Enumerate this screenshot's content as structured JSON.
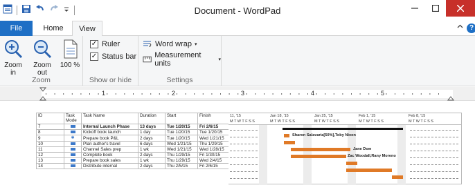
{
  "window": {
    "title": "Document - WordPad"
  },
  "tabs": {
    "file": "File",
    "home": "Home",
    "view": "View"
  },
  "ribbon": {
    "zoom_group": {
      "zoom_in": "Zoom in",
      "zoom_out": "Zoom out",
      "zoom_100": "100 %",
      "label": "Zoom"
    },
    "show_hide_group": {
      "ruler": "Ruler",
      "ruler_checked": true,
      "status_bar": "Status bar",
      "status_bar_checked": true,
      "label": "Show or hide"
    },
    "settings_group": {
      "word_wrap": "Word wrap",
      "measurement_units": "Measurement units",
      "label": "Settings"
    }
  },
  "ruler": {
    "marks": [
      "1",
      "2",
      "3",
      "4",
      "5"
    ]
  },
  "gantt": {
    "headers": {
      "id": "ID",
      "mode": "Task Mode",
      "name": "Task Name",
      "duration": "Duration",
      "start": "Start",
      "finish": "Finish"
    },
    "rows": [
      {
        "id": "7",
        "name": "Internal Launch Phase",
        "duration": "13 days",
        "start": "Tue 1/20/15",
        "finish": "Fri 2/6/15",
        "summary": true
      },
      {
        "id": "8",
        "name": "Kickoff book launch",
        "duration": "1 day",
        "start": "Tue 1/20/15",
        "finish": "Tue 1/20/15",
        "summary": false
      },
      {
        "id": "9",
        "name": "Prepare book P&L",
        "duration": "2 days",
        "start": "Tue 1/20/15",
        "finish": "Wed 1/21/15",
        "summary": false
      },
      {
        "id": "10",
        "name": "Plan author's travel",
        "duration": "6 days",
        "start": "Wed 1/21/15",
        "finish": "Thu 1/29/15",
        "summary": false
      },
      {
        "id": "11",
        "name": "Channel Sales prep",
        "duration": "1 wk",
        "start": "Wed 1/21/15",
        "finish": "Wed 1/28/15",
        "summary": false
      },
      {
        "id": "12",
        "name": "Complete book",
        "duration": "2 days",
        "start": "Thu 1/29/15",
        "finish": "Fri 1/30/15",
        "summary": false
      },
      {
        "id": "13",
        "name": "Prepare book sales",
        "duration": "1 wk",
        "start": "Thu 1/29/15",
        "finish": "Wed 2/4/15",
        "summary": false
      },
      {
        "id": "14",
        "name": "Distribute internal",
        "duration": "2 days",
        "start": "Thu 2/5/15",
        "finish": "Fri 2/6/15",
        "summary": false
      }
    ],
    "timescale": {
      "weeks": [
        "11, '15",
        "Jan 18, '15",
        "Jan 25, '15",
        "Feb 1, '15",
        "Feb 8, '15"
      ],
      "days": "M T W T F S S"
    },
    "bar_labels": {
      "row8": "Sharon Salavaria[50%],Toby Nixon",
      "row10": "Jane Dow",
      "row11": "Zac Woodall,Rany Moreno"
    }
  }
}
